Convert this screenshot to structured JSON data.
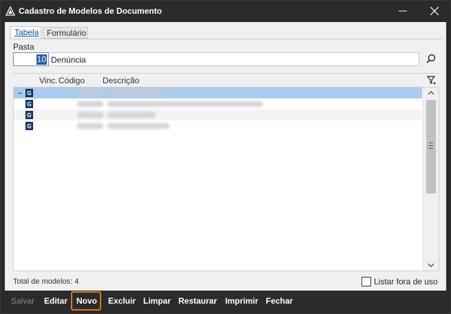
{
  "window": {
    "title": "Cadastro de Modelos de Documento"
  },
  "tabs": [
    {
      "label": "Tabela",
      "active": true
    },
    {
      "label": "Formulário",
      "active": false
    }
  ],
  "pasta": {
    "label": "Pasta",
    "code": "10",
    "description": "Denúncia"
  },
  "grid": {
    "columns": [
      "Vinc.",
      "Código",
      "Descrição"
    ],
    "rows": [
      {
        "badge": "G",
        "selected": true
      },
      {
        "badge": "G",
        "selected": false
      },
      {
        "badge": "G",
        "selected": false
      },
      {
        "badge": "G",
        "selected": false
      }
    ]
  },
  "footer": {
    "total": "Total de modelos: 4",
    "listar_label": "Listar fora de uso",
    "listar_checked": false
  },
  "toolbar": {
    "salvar": "Salvar",
    "editar": "Editar",
    "novo": "Novo",
    "excluir": "Excluir",
    "limpar": "Limpar",
    "restaurar": "Restaurar",
    "imprimir": "Imprimir",
    "fechar": "Fechar"
  },
  "colors": {
    "titlebar": "#2b2b2b",
    "panel": "#f0f0f0",
    "selection": "#a9ccee",
    "highlight": "#e07a1e"
  }
}
